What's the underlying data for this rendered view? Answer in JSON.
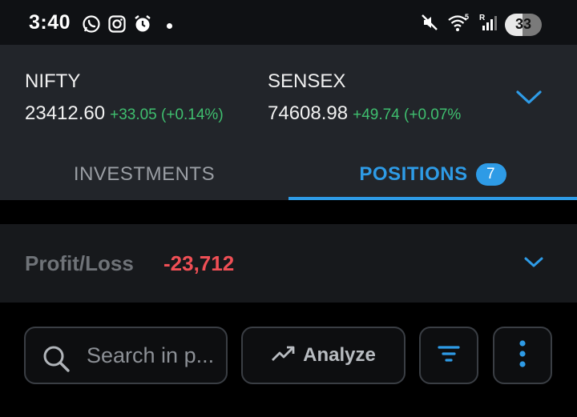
{
  "status_bar": {
    "time": "3:40",
    "left_icons": [
      "whatsapp-icon",
      "instagram-icon",
      "alarm-icon",
      "dot-icon"
    ],
    "right_icons": [
      "mute-icon",
      "wifi-icon",
      "signal-icon"
    ],
    "battery": "33"
  },
  "indices": [
    {
      "name": "NIFTY",
      "value": "23412.60",
      "change": "+33.05 (+0.14%)"
    },
    {
      "name": "SENSEX",
      "value": "74608.98",
      "change": "+49.74 (+0.07%"
    }
  ],
  "tabs": [
    {
      "label": "INVESTMENTS",
      "active": false
    },
    {
      "label": "POSITIONS",
      "badge": "7",
      "active": true
    }
  ],
  "pnl": {
    "label": "Profit/Loss",
    "value": "-23,712"
  },
  "toolbar": {
    "search_placeholder": "Search in p...",
    "analyze_label": "Analyze"
  },
  "colors": {
    "accent": "#2e9be6",
    "positive": "#3fbf6f",
    "negative": "#ef4f55",
    "panel": "#22252a"
  }
}
